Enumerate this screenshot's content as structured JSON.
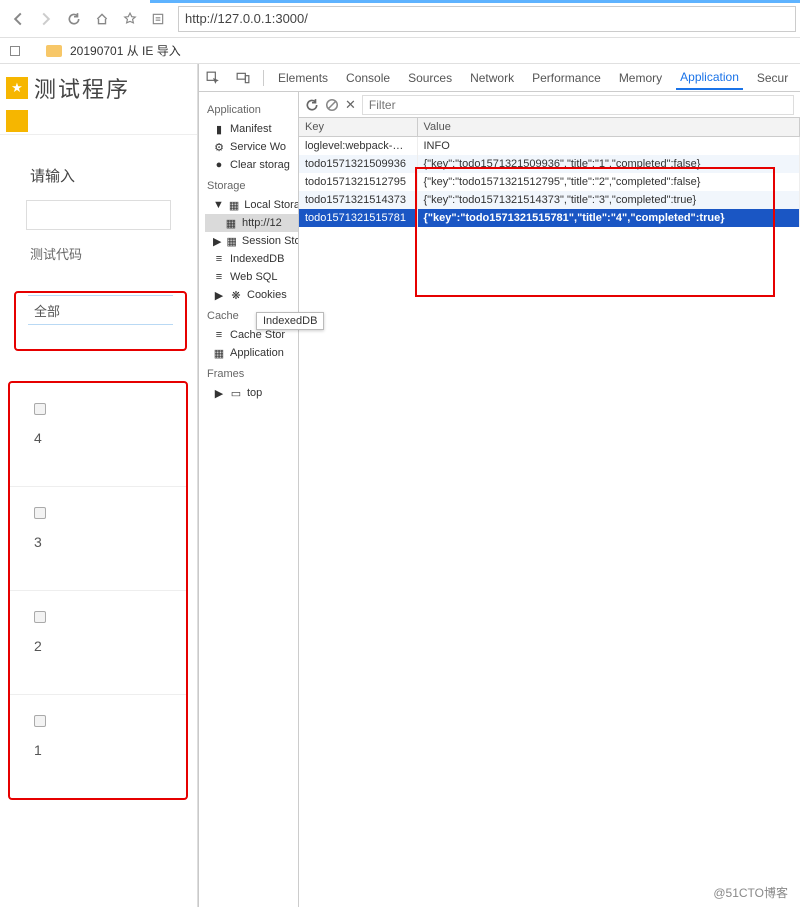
{
  "browser": {
    "url": "http://127.0.0.1:3000/",
    "bookmark": "20190701 从 IE 导入"
  },
  "app": {
    "title": "测试程序",
    "input_label": "请输入",
    "code_label": "测试代码",
    "filter_tab": "全部",
    "todos": [
      {
        "title": "4"
      },
      {
        "title": "3"
      },
      {
        "title": "2"
      },
      {
        "title": "1"
      }
    ]
  },
  "devtools": {
    "tabs": [
      "Elements",
      "Console",
      "Sources",
      "Network",
      "Performance",
      "Memory",
      "Application",
      "Secur"
    ],
    "active_tab": "Application",
    "filter_placeholder": "Filter",
    "tooltip": "IndexedDB",
    "sidebar": {
      "application": {
        "title": "Application",
        "items": [
          "Manifest",
          "Service Wo",
          "Clear storag"
        ]
      },
      "storage": {
        "title": "Storage",
        "items": [
          "Local Stora",
          "http://12",
          "Session Sto",
          "IndexedDB",
          "Web SQL",
          "Cookies"
        ]
      },
      "cache": {
        "title": "Cache",
        "items": [
          "Cache Stor",
          "Application"
        ]
      },
      "frames": {
        "title": "Frames",
        "items": [
          "top"
        ]
      }
    },
    "table": {
      "headers": [
        "Key",
        "Value"
      ],
      "rows": [
        {
          "k": "loglevel:webpack-…",
          "v": "INFO"
        },
        {
          "k": "todo1571321509936",
          "v": "{\"key\":\"todo1571321509936\",\"title\":\"1\",\"completed\":false}"
        },
        {
          "k": "todo1571321512795",
          "v": "{\"key\":\"todo1571321512795\",\"title\":\"2\",\"completed\":false}"
        },
        {
          "k": "todo1571321514373",
          "v": "{\"key\":\"todo1571321514373\",\"title\":\"3\",\"completed\":true}"
        },
        {
          "k": "todo1571321515781",
          "v": "{\"key\":\"todo1571321515781\",\"title\":\"4\",\"completed\":true}"
        }
      ],
      "selected_index": 4
    }
  },
  "watermark": "@51CTO博客"
}
